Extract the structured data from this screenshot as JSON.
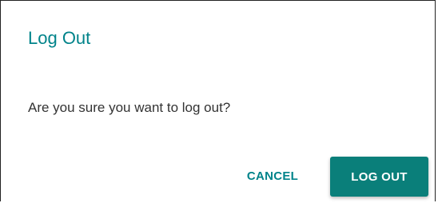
{
  "dialog": {
    "title": "Log Out",
    "message": "Are you sure you want to log out?",
    "cancel_label": "CANCEL",
    "confirm_label": "LOG OUT"
  },
  "colors": {
    "accent": "#00838a",
    "primary_button": "#0a7f7a",
    "text": "#333333"
  }
}
